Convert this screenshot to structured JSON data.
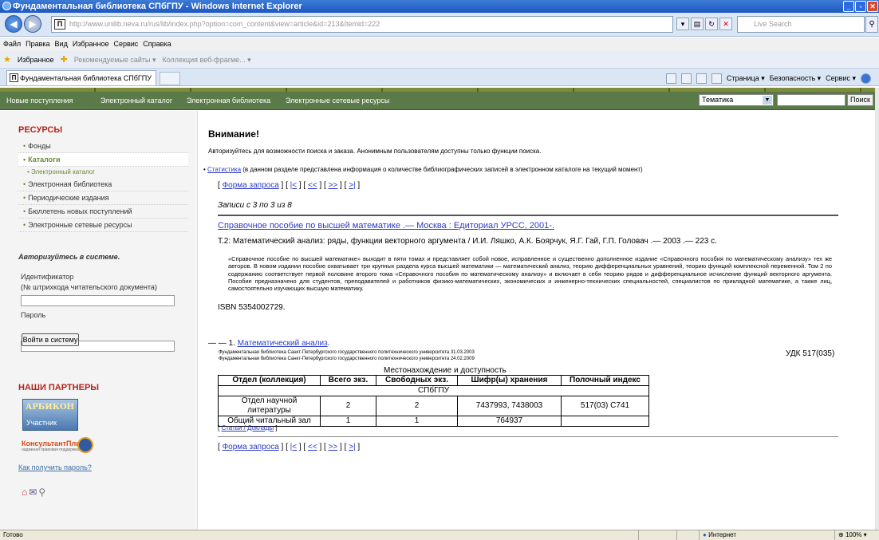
{
  "window": {
    "title": "Фундаментальная библиотека СПбГПУ - Windows Internet Explorer"
  },
  "address": {
    "url": "http://www.unilib.neva.ru/rus/lib/index.php?option=com_content&view=article&id=213&Itemid=222",
    "live_search": "Live Search"
  },
  "menubar": [
    "Файл",
    "Правка",
    "Вид",
    "Избранное",
    "Сервис",
    "Справка"
  ],
  "favbar": {
    "favorites": "Избранное",
    "recommended": "Рекомендуемые сайты ▾",
    "gallery": "Коллекция веб-фрагме... ▾"
  },
  "tab": {
    "title": "Фундаментальная библиотека СПбГПУ"
  },
  "cmdbar": {
    "page": "Страница ▾",
    "safety": "Безопасность ▾",
    "service": "Сервис ▾"
  },
  "sitenav": {
    "items": [
      "Новые поступления",
      "Электронный каталог",
      "Электронная библиотека",
      "Электронные сетевые ресурсы"
    ],
    "theme": "Тематика",
    "search_btn": "Поиск"
  },
  "sidebar": {
    "resources": "РЕСУРСЫ",
    "items": [
      "Фонды",
      "Каталоги",
      "Электронная библиотека",
      "Периодические издания",
      "Бюллетень новых поступлений",
      "Электронные сетевые ресурсы"
    ],
    "sub": "Электронный каталог",
    "auth_head": "Авторизуйтесь в системе.",
    "id_label": "Идентификатор",
    "id_hint": "(№ штрихкода читательского документа)",
    "pwd_label": "Пароль",
    "login": "Войти в систему",
    "forgot": "Как получить пароль?",
    "partners": "НАШИ ПАРТНЕРЫ",
    "arbicon": "АРБИКОН",
    "arbicon_sub": "Участник",
    "consult": "КонсультантПлюс",
    "consult_sub": "надежная правовая поддержка"
  },
  "main": {
    "attention": "Внимание!",
    "auth_note": "Авторизуйтесь для возможности поиска и заказа. Анонимным пользователям доступны только функции поиска.",
    "stat_link": "Статистика",
    "stat_text": " (в данном разделе представлена информация о количестве библиографических записей в электронном каталоге на текущий момент)",
    "pager": {
      "form": "Форма запроса",
      "first": "|<",
      "prev": "<<",
      "next": ">>",
      "last": ">|"
    },
    "records": "Записи с 3 по 3 из 8",
    "ref_link": "Справочное пособие по высшей математике .— Москва : Едиториал УРСС, 2001-.",
    "desc": "Т.2: Математический анализ: ряды, функции векторного аргумента / И.И. Ляшко, А.К. Боярчук, Я.Г. Гай, Г.П. Головач .— 2003 .— 223 с.",
    "abstract": "«Справочное пособие по высшей математике» выходит в пяти томах и представляет собой новое, исправленное и существенно дополненное издание «Справочного пособия по математическому анализу» тех же авторов. В новом издании пособие охватывает три крупных раздела курса высшей математики — математический анализ, теорию дифференциальных уравнений, теорию функций комплексной переменной. Том 2 по содержанию соответствует первой половине второго тома «Справочного пособия по математическому анализу» и включает в себя теорию рядов и дифференциальное исчисление функций векторного аргумента. Пособие предназначено для студентов, преподавателей и работников физико-математических, экономических и инженерно-технических специальностей, специалистов по прикладной математике, а также лиц, самостоятельно изучающих высшую математику.",
    "isbn": "ISBN 5354002729.",
    "seq_prefix": "— — 1. ",
    "seq_link": "Математический анализ",
    "lib1": "Фундаментальная библиотека Санкт-Петербургского государственного политехнического университета 31.03.2003",
    "lib2": "Фундаментальная библиотека Санкт-Петербургского государственного политехнического университета 24.02.2009",
    "udk": "УДК 517(035)",
    "loc_caption": "Местонахождение и доступность",
    "loc_headers": [
      "Отдел (коллекция)",
      "Всего экз.",
      "Свободных экз.",
      "Шифр(ы) хранения",
      "Полочный индекс"
    ],
    "loc_group": "СПбГПУ",
    "loc_rows": [
      [
        "Отдел научной литературы",
        "2",
        "2",
        "7437993, 7438003",
        "517(03) C741"
      ],
      [
        "Общий читальный зал",
        "1",
        "1",
        "764937",
        ""
      ]
    ],
    "articles": "Статьи / Доклады"
  },
  "status": {
    "ready": "Готово",
    "zone": "Интернет",
    "zoom": "100%"
  }
}
